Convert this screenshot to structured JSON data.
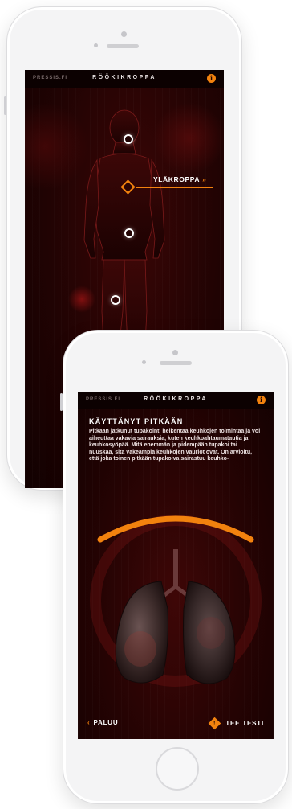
{
  "screen1": {
    "brand": "PRESSIS.FI",
    "title": "RÖÖKIKROPPA",
    "info_icon": "info-icon",
    "body_label": "YLÄKROPPA",
    "label_chevron": "»"
  },
  "screen2": {
    "brand": "PRESSIS.FI",
    "title": "RÖÖKIKROPPA",
    "info_icon": "info-icon",
    "heading": "KÄYTTÄNYT PITKÄÄN",
    "body": "Pitkään jatkunut tupakointi heikentää keuhkojen toimintaa ja voi aiheuttaa vakavia sairauksia, kuten keuhkoahtaumatautia ja keuhkosyöpää. Mitä enemmän ja pidempään tupakoi tai nuuskaa, sitä vakeampia keuhkojen vauriot ovat. On arvioitu, että joka toinen pitkään tupakoiva sairastuu keuhko-",
    "back_label": "PALUU",
    "back_chevron": "‹",
    "test_label": "TEE TESTI",
    "test_icon_glyph": "!"
  },
  "colors": {
    "accent": "#f2820e",
    "screen_bg": "#1f0303",
    "text": "#ffffff"
  }
}
